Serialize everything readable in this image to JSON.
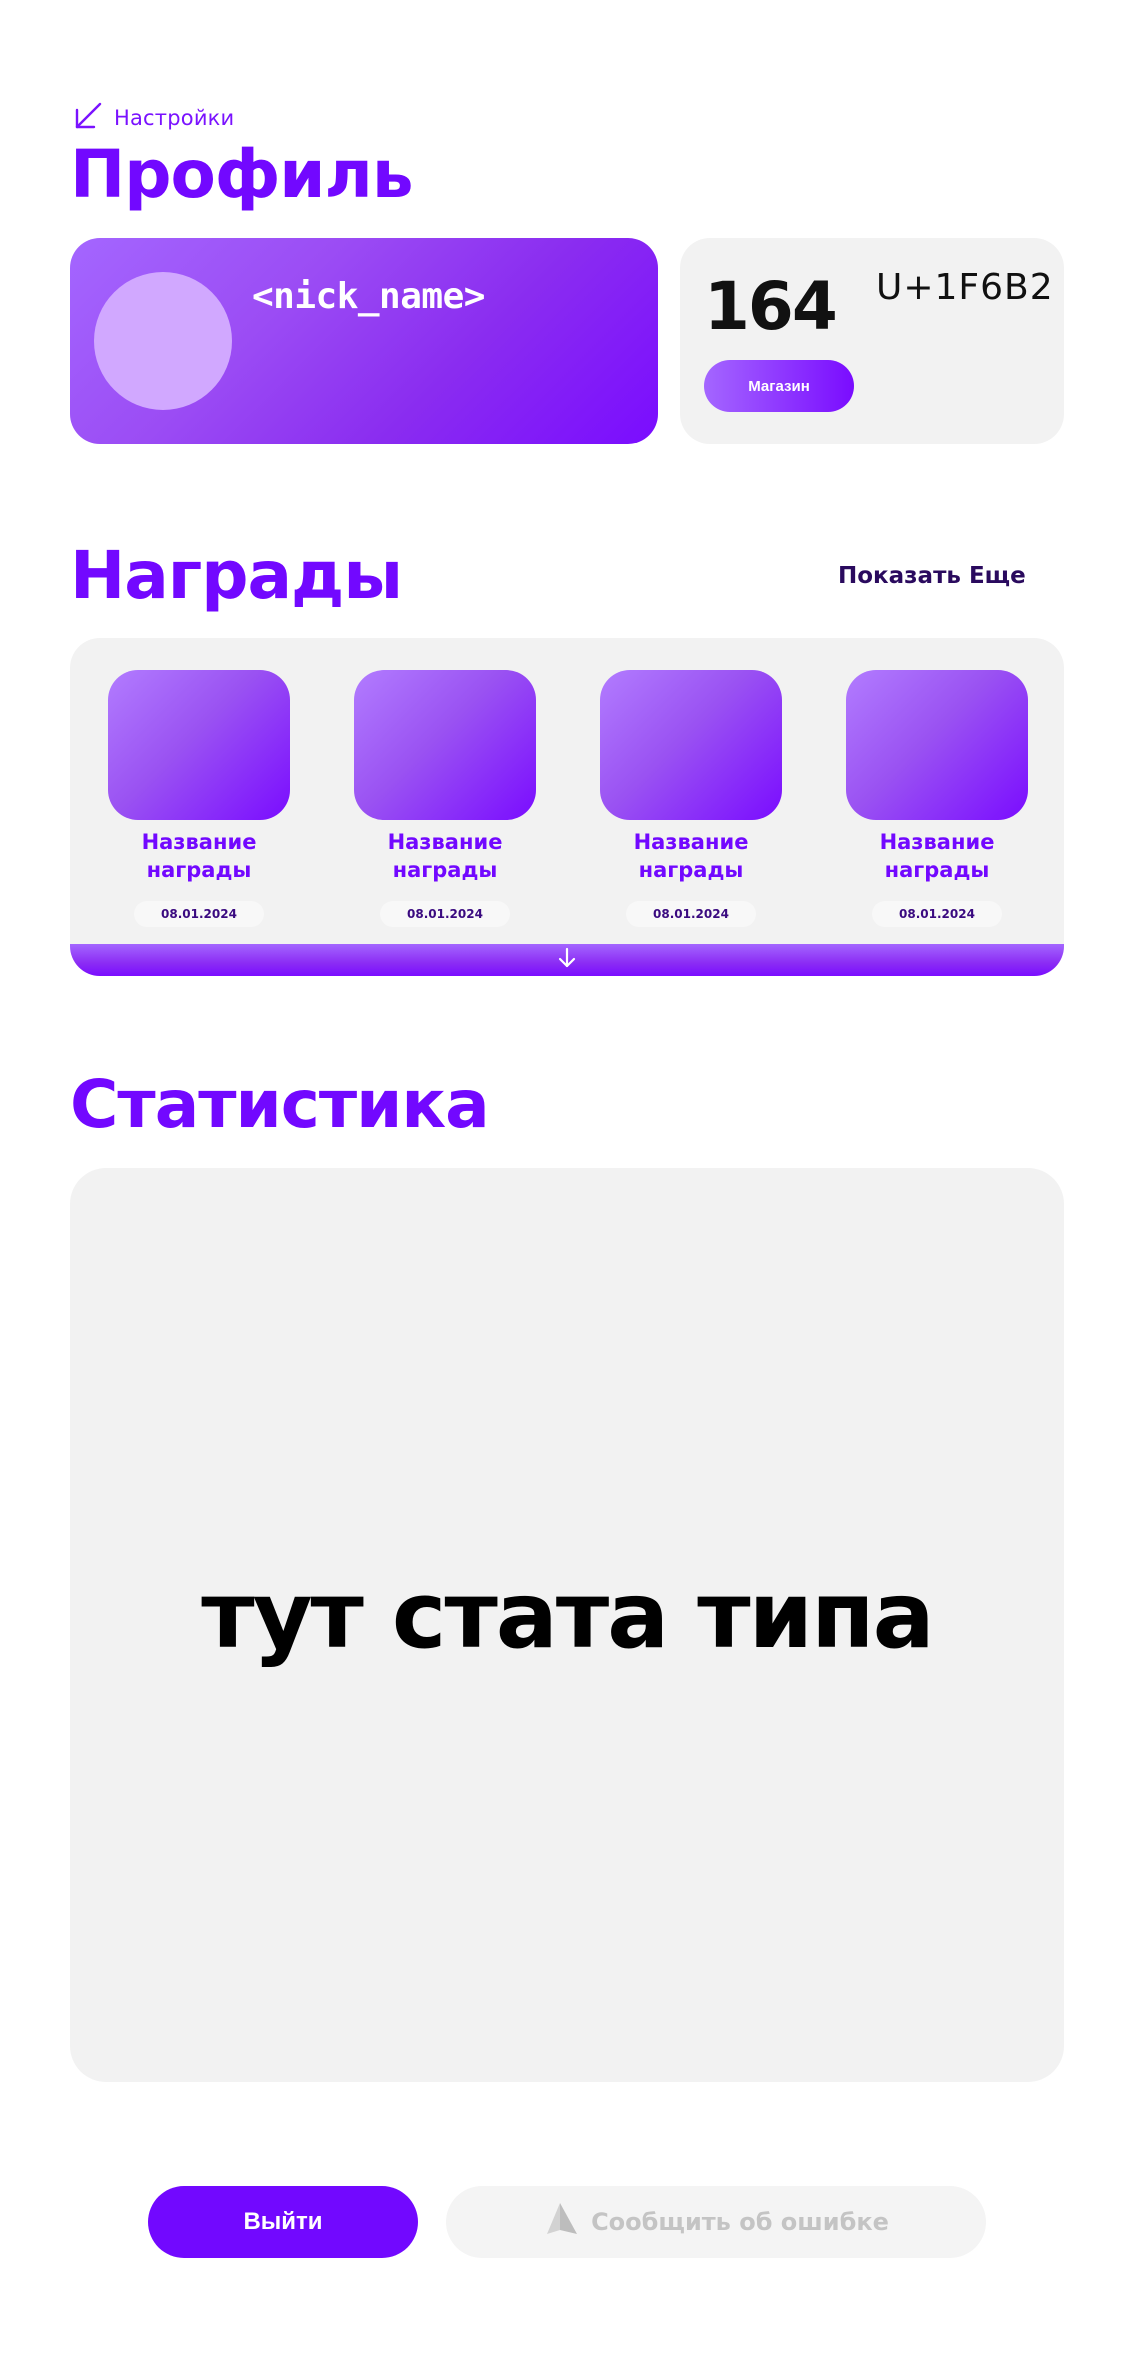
{
  "header": {
    "back_label": "Настройки",
    "back_icon": "arrow-down-left-icon",
    "title": "Профиль"
  },
  "profile": {
    "nick": "<nick_name>",
    "balance": "164",
    "currency_code": "U+1F6B2",
    "shop_label": "Магазин"
  },
  "awards": {
    "title": "Награды",
    "show_more": "Показать Еще",
    "items": [
      {
        "name": "Название награды",
        "date": "08.01.2024"
      },
      {
        "name": "Название награды",
        "date": "08.01.2024"
      },
      {
        "name": "Название награды",
        "date": "08.01.2024"
      },
      {
        "name": "Название награды",
        "date": "08.01.2024"
      }
    ],
    "expand_icon": "arrow-down-icon"
  },
  "stats": {
    "title": "Статистика",
    "placeholder": "тут стата типа"
  },
  "footer": {
    "logout_label": "Выйти",
    "report_label": "Сообщить об ошибке",
    "report_icon": "sail-icon"
  },
  "colors": {
    "accent": "#7208ff",
    "panel": "#f2f2f2"
  }
}
